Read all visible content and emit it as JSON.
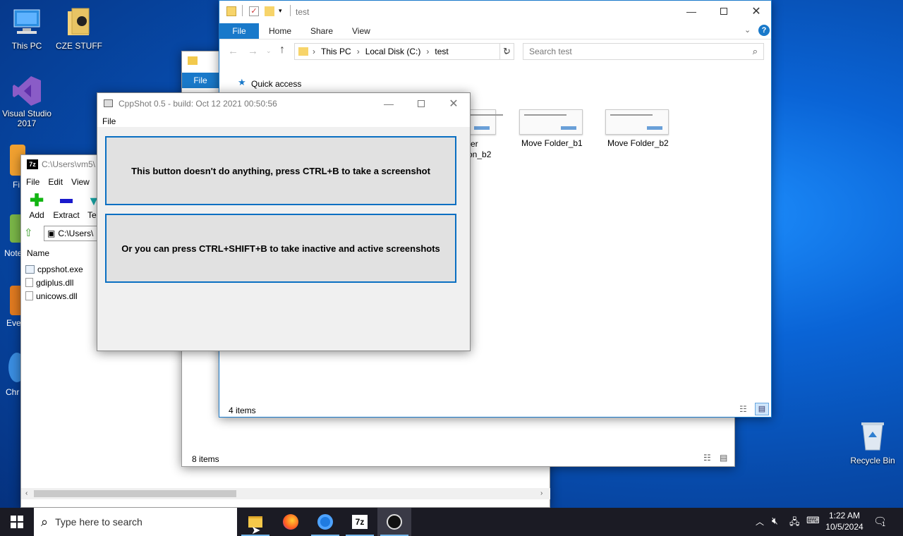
{
  "desktop": {
    "icons": [
      {
        "label": "This PC",
        "icon": "computer-icon"
      },
      {
        "label": "CZE STUFF",
        "icon": "folder-icon"
      },
      {
        "label": "Visual Studio 2017",
        "icon": "visual-studio-icon"
      },
      {
        "label": "Recycle Bin",
        "icon": "recycle-bin-icon"
      }
    ],
    "partial_labels": [
      "Fi",
      "Note",
      "Eve",
      "Chr"
    ]
  },
  "explorer_test": {
    "title": "test",
    "tabs": [
      "File",
      "Home",
      "Share",
      "View"
    ],
    "breadcrumb": [
      "This PC",
      "Local Disk (C:)",
      "test"
    ],
    "search_placeholder": "Search test",
    "quick_access": "Quick access",
    "items": [
      {
        "label": "Move Folder_b1"
      },
      {
        "label": "Move Folder_b2"
      }
    ],
    "partial_item_lines": [
      "er",
      "on_b2"
    ],
    "status": "4 items",
    "accent": "#1979ca"
  },
  "explorer_back": {
    "tab_file": "File",
    "status": "8 items"
  },
  "sevenzip": {
    "title": "C:\\Users\\vm5\\",
    "menu": [
      "File",
      "Edit",
      "View"
    ],
    "toolbar": [
      {
        "label": "Add"
      },
      {
        "label": "Extract"
      },
      {
        "label": "Te"
      }
    ],
    "path": "C:\\Users\\",
    "column_header": "Name",
    "files": [
      "cppshot.exe",
      "gdiplus.dll",
      "unicows.dll"
    ]
  },
  "cppshot": {
    "title": "CppShot 0.5 - build: Oct 12 2021 00:50:56",
    "menu": "File",
    "button1": "This button doesn't do anything, press CTRL+B to take a screenshot",
    "button2": "Or you can press CTRL+SHIFT+B to take inactive and active screenshots"
  },
  "taskbar": {
    "search_placeholder": "Type here to search",
    "time": "1:22 AM",
    "date": "10/5/2024",
    "notification_count": "1"
  }
}
